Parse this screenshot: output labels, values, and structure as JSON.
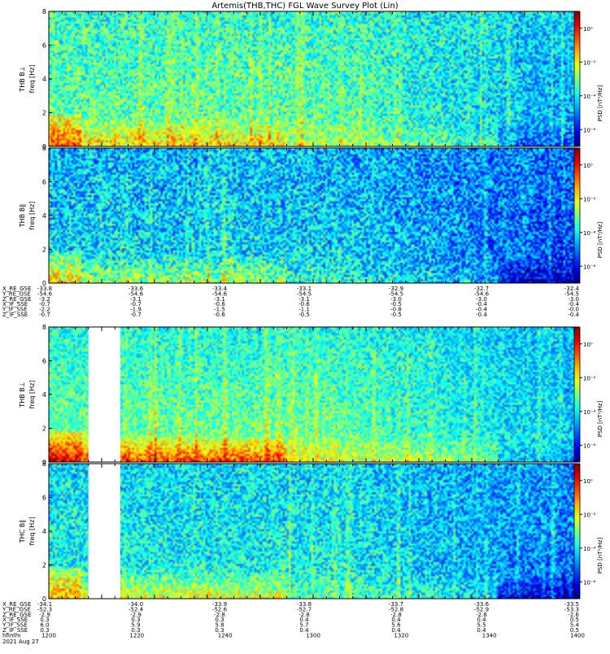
{
  "chart_data": {
    "type": "heatmap",
    "title": "Artemis(THB,THC) FGL Wave Survey Plot (Lin)",
    "colorbar": {
      "label": "PSD [nT²/Hz]",
      "ticks": [
        {
          "label": "10⁰",
          "exp": 0
        },
        {
          "label": "10⁻²",
          "exp": -2
        },
        {
          "label": "10⁻⁴",
          "exp": -4
        },
        {
          "label": "10⁻⁶",
          "exp": -6
        }
      ],
      "range_exp": [
        -7,
        1
      ]
    },
    "freq_ticks": [
      0,
      2,
      4,
      6,
      8
    ],
    "freq_range": [
      0,
      8
    ],
    "groups": [
      {
        "panels": [
          {
            "probe": "THB",
            "ylabel1": "THB B⊥",
            "ylabel2": "freq [Hz]"
          },
          {
            "probe": "THB",
            "ylabel1": "THB B∥",
            "ylabel2": "freq [Hz]"
          }
        ],
        "ephemeris": [
          {
            "label": "X_RE_GSE",
            "values": [
              "-33.8",
              "-33.6",
              "-33.4",
              "-33.1",
              "-32.9",
              "-32.7",
              "-32.4"
            ]
          },
          {
            "label": "Y_RE_GSE",
            "values": [
              "-54.6",
              "-54.6",
              "-54.6",
              "-54.5",
              "-54.5",
              "-54.6",
              "-54.5"
            ]
          },
          {
            "label": "Z_RE_GSE",
            "values": [
              "-3.2",
              "-3.1",
              "-3.1",
              "-3.1",
              "-3.0",
              "-3.0",
              "-3.0"
            ]
          },
          {
            "label": "X_IF_SSE",
            "values": [
              "-0.7",
              "-0.7",
              "-0.6",
              "-0.6",
              "-0.5",
              "-0.4",
              "-0.4"
            ]
          },
          {
            "label": "Y_IF_SSE",
            "values": [
              "-2.2",
              "-1.9",
              "-1.5",
              "-1.1",
              "-0.8",
              "-0.4",
              "-0.0"
            ]
          },
          {
            "label": "Z_IF_SSE",
            "values": [
              "-0.7",
              "-0.7",
              "-0.6",
              "-0.5",
              "-0.5",
              "-0.4",
              "-0.4"
            ]
          }
        ]
      },
      {
        "panels": [
          {
            "probe": "THB",
            "ylabel1": "THB B⊥",
            "ylabel2": "freq [Hz]"
          },
          {
            "probe": "THC",
            "ylabel1": "THC B∥",
            "ylabel2": "freq [Hz]"
          }
        ],
        "ephemeris": [
          {
            "label": "X_RE_GSE",
            "values": [
              "-34.1",
              "-34.0",
              "-33.9",
              "-33.8",
              "-33.7",
              "-33.6",
              "-33.5"
            ]
          },
          {
            "label": "Y_RE_GSE",
            "values": [
              "-52.3",
              "-52.4",
              "-52.6",
              "-52.7",
              "-52.8",
              "-52.9",
              "-53.3"
            ]
          },
          {
            "label": "Z_RE_GSE",
            "values": [
              "-2.9",
              "-2.9",
              "-2.8",
              "-2.8",
              "-2.8",
              "-2.8",
              "-2.6"
            ]
          },
          {
            "label": "X_IF_SSE",
            "values": [
              "0.3",
              "0.3",
              "0.3",
              "0.4",
              "0.4",
              "0.4",
              "0.5"
            ]
          },
          {
            "label": "Y_IF_SSE",
            "values": [
              "6.0",
              "5.9",
              "5.8",
              "5.7",
              "5.6",
              "5.5",
              "5.4"
            ]
          },
          {
            "label": "Z_IF_SSE",
            "values": [
              "0.3",
              "0.3",
              "0.3",
              "0.4",
              "0.4",
              "0.4",
              "0.5"
            ]
          }
        ],
        "time_labels": [
          "1200",
          "1220",
          "1240",
          "1300",
          "1320",
          "1340",
          "1400"
        ],
        "time_row_label": "hhmm",
        "date_label": "2021 Aug 27",
        "data_gap_hhmm": [
          "1215",
          "1227"
        ]
      }
    ]
  }
}
